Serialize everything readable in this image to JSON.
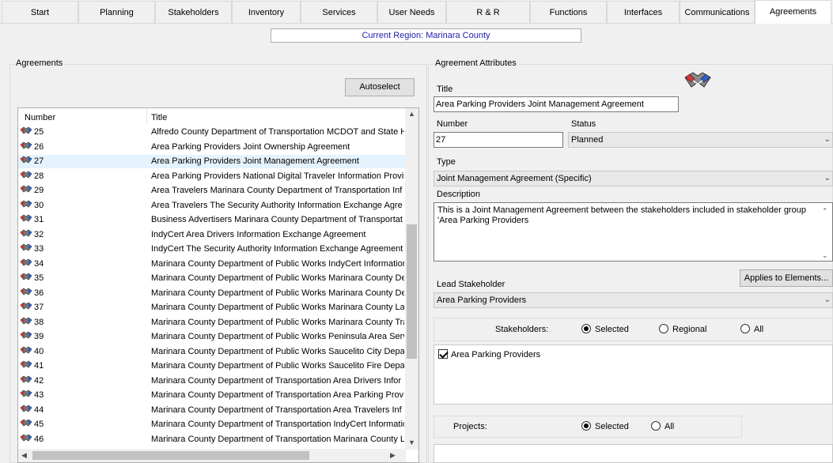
{
  "tabs": [
    {
      "label": "Start"
    },
    {
      "label": "Planning"
    },
    {
      "label": "Stakeholders"
    },
    {
      "label": "Inventory"
    },
    {
      "label": "Services"
    },
    {
      "label": "User Needs"
    },
    {
      "label": "R & R"
    },
    {
      "label": "Functions"
    },
    {
      "label": "Interfaces"
    },
    {
      "label": "Communications"
    },
    {
      "label": "Agreements"
    }
  ],
  "active_tab": "Agreements",
  "region": {
    "text": "Current Region: Marinara County"
  },
  "agreements_panel": {
    "title": "Agreements",
    "autoselect_label": "Autoselect",
    "columns": {
      "number": "Number",
      "title": "Title"
    },
    "rows": [
      {
        "number": "25",
        "title": "Alfredo County Department of Transportation MCDOT and State Hi"
      },
      {
        "number": "26",
        "title": "Area Parking Providers Joint Ownership Agreement"
      },
      {
        "number": "27",
        "title": "Area Parking Providers Joint Management Agreement"
      },
      {
        "number": "28",
        "title": "Area Parking Providers National Digital Traveler Information Provis"
      },
      {
        "number": "29",
        "title": "Area Travelers Marinara County Department of Transportation Inf"
      },
      {
        "number": "30",
        "title": "Area Travelers The Security Authority Information Exchange Agre"
      },
      {
        "number": "31",
        "title": "Business Advertisers Marinara County Department of Transportat"
      },
      {
        "number": "32",
        "title": "IndyCert Area Drivers Information Exchange Agreement"
      },
      {
        "number": "33",
        "title": "IndyCert The Security Authority Information Exchange Agreement"
      },
      {
        "number": "34",
        "title": "Marinara County Department of Public Works IndyCert Informatior"
      },
      {
        "number": "35",
        "title": "Marinara County Department of Public Works Marinara County De"
      },
      {
        "number": "36",
        "title": "Marinara County Department of Public Works Marinara County De"
      },
      {
        "number": "37",
        "title": "Marinara County Department of Public Works Marinara County La"
      },
      {
        "number": "38",
        "title": "Marinara County Department of Public Works Marinara County Tra"
      },
      {
        "number": "39",
        "title": "Marinara County Department of Public Works Peninsula Area Serv"
      },
      {
        "number": "40",
        "title": "Marinara County Department of Public Works Saucelito City Depa"
      },
      {
        "number": "41",
        "title": "Marinara County Department of Public Works Saucelito Fire Depa"
      },
      {
        "number": "42",
        "title": "Marinara County Department of Transportation Area Drivers Infor"
      },
      {
        "number": "43",
        "title": "Marinara County Department of Transportation Area Parking Prov"
      },
      {
        "number": "44",
        "title": "Marinara County Department of Transportation Area Travelers Inf"
      },
      {
        "number": "45",
        "title": "Marinara County Department of Transportation IndyCert Informatio"
      },
      {
        "number": "46",
        "title": "Marinara County Department of Transportation Marinara County L"
      }
    ],
    "selected_number": "27"
  },
  "attributes_panel": {
    "title": "Agreement Attributes",
    "title_label": "Title",
    "title_value": "Area Parking Providers Joint Management Agreement",
    "number_label": "Number",
    "number_value": "27",
    "status_label": "Status",
    "status_value": "Planned",
    "type_label": "Type",
    "type_value": "Joint Management Agreement (Specific)",
    "description_label": "Description",
    "description_value": "This is a Joint Management Agreement between the stakeholders included in stakeholder group 'Area Parking Providers",
    "applies_button": "Applies to Elements...",
    "lead_label": "Lead Stakeholder",
    "lead_value": "Area Parking Providers",
    "stakeholders_label": "Stakeholders:",
    "stakeholder_filter": {
      "selected": "Selected",
      "regional": "Regional",
      "all": "All"
    },
    "stakeholder_items": [
      "Area Parking Providers"
    ],
    "projects_label": "Projects:",
    "project_filter": {
      "selected": "Selected",
      "all": "All"
    }
  },
  "colors": {
    "selected_row": "#e5f3ff",
    "region_text": "#1d1db0"
  },
  "icons": {
    "agreement": "handshake-icon"
  }
}
